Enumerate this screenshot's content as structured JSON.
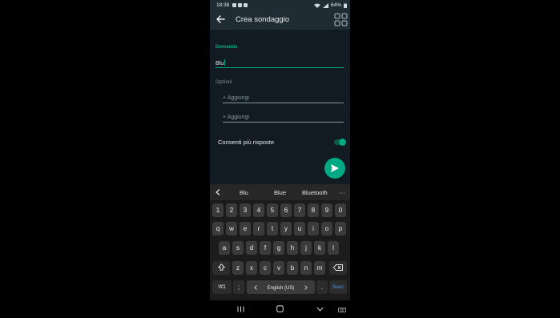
{
  "status_bar": {
    "time": "18:38",
    "battery": "64%"
  },
  "header": {
    "title": "Crea sondaggio"
  },
  "form": {
    "question_label": "Domanda",
    "question_value": "Blu",
    "options_label": "Opzioni",
    "option_placeholders": [
      "+ Aggiungi",
      "+ Aggiungi"
    ],
    "multi_answer_label": "Consenti più risposte",
    "multi_answer_enabled": true
  },
  "keyboard": {
    "suggestions": [
      "Blu",
      "Blue",
      "Bluetooth"
    ],
    "more_label": "···",
    "row_numbers": [
      "1",
      "2",
      "3",
      "4",
      "5",
      "6",
      "7",
      "8",
      "9",
      "0"
    ],
    "row_1": [
      "q",
      "w",
      "e",
      "r",
      "t",
      "y",
      "u",
      "i",
      "o",
      "p"
    ],
    "row_2": [
      "a",
      "s",
      "d",
      "f",
      "g",
      "h",
      "j",
      "k",
      "l"
    ],
    "row_3": [
      "z",
      "x",
      "c",
      "v",
      "b",
      "n",
      "m"
    ],
    "symbols_label": "!#1",
    "comma_label": ";",
    "space_label": "English (US)",
    "period_label": ".",
    "enter_label": "Succ"
  },
  "colors": {
    "accent": "#00a884",
    "background": "#121b22",
    "header": "#1f2c34",
    "keyboard": "#1c1c1c"
  },
  "icons": [
    "back-arrow-icon",
    "grid-icon",
    "send-icon",
    "shift-icon",
    "backspace-icon",
    "chevron-left-icon",
    "recents-icon",
    "home-icon",
    "back-nav-icon",
    "keyboard-icon"
  ]
}
